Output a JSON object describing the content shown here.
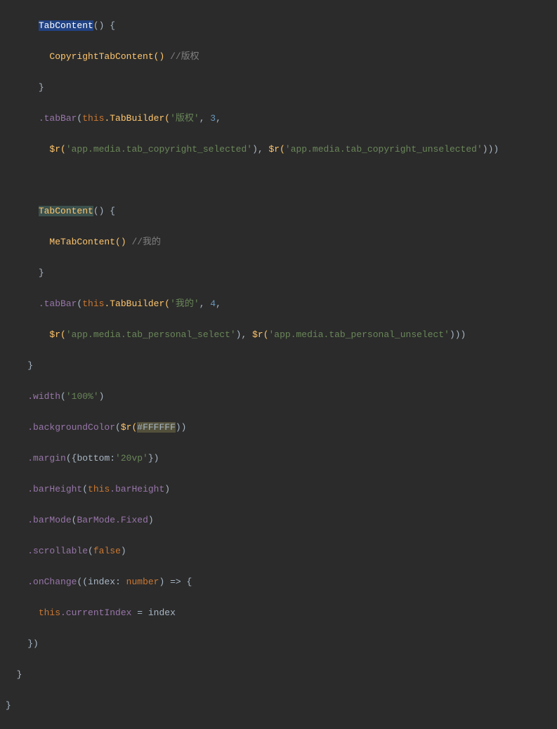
{
  "code": {
    "tokens": {
      "TabContent": "TabContent",
      "openParenBrace": "() {",
      "CopyrightTabContent": "CopyrightTabContent()",
      "commentCopyright": "//版权",
      "closeBrace": "}",
      "tabBar": ".tabBar",
      "openParen": "(",
      "this": "this",
      "dotTabBuilder": ".TabBuilder(",
      "strCopyright": "'版权'",
      "comma": ", ",
      "num3": "3",
      "dollarR": "$r(",
      "strTabCopyrightSel": "'app.media.tab_copyright_selected'",
      "closeParen": ")",
      "strTabCopyrightUnsel": "'app.media.tab_copyright_unselected'",
      "closeParen3": ")))",
      "MeTabContent": "MeTabContent()",
      "commentMe": "//我的",
      "strMe": "'我的'",
      "num4": "4",
      "strTabPersonalSel": "'app.media.tab_personal_select'",
      "strTabPersonalUnsel": "'app.media.tab_personal_unselect'",
      "width": ".width",
      "str100": "'100%'",
      "backgroundColor": ".backgroundColor",
      "colorFFFFFF": "#FFFFFF",
      "closeParen2": "))",
      "margin": ".margin",
      "openBrace": "({",
      "bottom": "bottom:",
      "str20vp": "'20vp'",
      "closeBraceParen": "})",
      "barHeight": ".barHeight",
      "thisBarHeight": ".barHeight",
      "barMode": ".barMode",
      "BarMode": "BarMode",
      "dotFixed": ".Fixed",
      "scrollable": ".scrollable",
      "false": "false",
      "onChange": ".onChange",
      "openParen2": "((",
      "index": "index",
      "colon": ": ",
      "number": "number",
      "arrow": ") => {",
      "currentIndex": ".currentIndex",
      "equals": " = ",
      "indexVar": "index"
    }
  }
}
